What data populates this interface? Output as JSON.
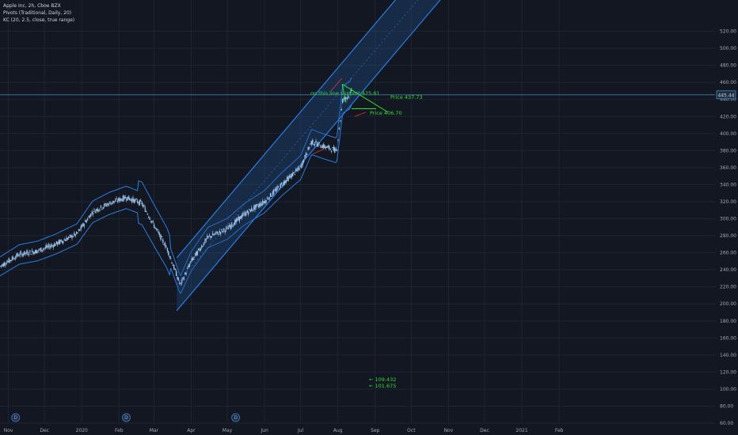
{
  "legend": {
    "symbol_line": "Apple Inc, 2h, Cboe BZX",
    "pivots_line": "Pivots (Traditional, Daily, 20)",
    "kc_line": "KC (20, 2.5, close, true range)"
  },
  "colors": {
    "background": "#131722",
    "grid": "#1f2433",
    "axis_text": "#a4a7b0",
    "channel_line": "#2a7de0",
    "channel_fill": "#1f4f8a",
    "candle": "#9fc5e8",
    "annotation_green": "#2fe02f",
    "annotation_red": "#d9313b",
    "price_line": "#4b8dbf"
  },
  "icons": {
    "dividend_marker": "circle-letter-D"
  },
  "chart_data": {
    "type": "candlestick",
    "symbol": "Apple Inc",
    "interval": "2h",
    "exchange": "Cboe BZX",
    "ylim": [
      60,
      540
    ],
    "y_ticks": [
      60,
      80,
      100,
      120,
      140,
      160,
      180,
      200,
      220,
      240,
      260,
      280,
      300,
      320,
      340,
      360,
      380,
      400,
      420,
      440,
      460,
      480,
      500,
      520
    ],
    "x_ticks": [
      "Nov",
      "Dec",
      "2020",
      "Feb",
      "Mar",
      "Apr",
      "May",
      "Jun",
      "Jul",
      "Aug",
      "Sep",
      "Oct",
      "Nov",
      "Dec",
      "2021",
      "Feb"
    ],
    "price_series": {
      "name": "Apple Inc",
      "x": [
        "2019-10-25",
        "2019-11-10",
        "2019-11-25",
        "2019-12-10",
        "2019-12-28",
        "2020-01-10",
        "2020-01-24",
        "2020-02-07",
        "2020-02-20",
        "2020-03-02",
        "2020-03-12",
        "2020-03-23",
        "2020-04-01",
        "2020-04-15",
        "2020-05-01",
        "2020-05-15",
        "2020-06-01",
        "2020-06-15",
        "2020-07-01",
        "2020-07-10",
        "2020-07-20",
        "2020-07-31",
        "2020-08-05",
        "2020-08-11",
        "2020-08-13"
      ],
      "values": [
        244,
        258,
        262,
        270,
        282,
        308,
        318,
        325,
        318,
        290,
        265,
        222,
        250,
        278,
        288,
        305,
        320,
        340,
        360,
        390,
        385,
        380,
        440,
        445,
        452
      ]
    },
    "current_price": "445.44",
    "channel": {
      "start": {
        "x": "2020-03-20",
        "y": 192
      },
      "end": {
        "x": "2020-10-30",
        "y": 565
      },
      "width": 62
    },
    "keltner_channel": {
      "length": 20,
      "multiplier": 2.5,
      "source": "close",
      "type": "true range"
    },
    "pivots": {
      "type": "Traditional",
      "timeframe": "Daily",
      "count": 20
    },
    "dividend_markers": [
      "Nov",
      "Feb",
      "May"
    ],
    "annotations": [
      {
        "text": "on this line support 425.61",
        "x": "2020-08-08",
        "y": 426
      },
      {
        "text": "Price 437.73",
        "x": "2020-08-29",
        "y": 427
      },
      {
        "text": "Price 406.70",
        "x": "2020-08-27",
        "y": 408
      },
      {
        "text": "← 109.432",
        "x": "2020-08-29",
        "y": 107
      },
      {
        "text": "← 101.675",
        "x": "2020-08-29",
        "y": 99
      }
    ]
  }
}
